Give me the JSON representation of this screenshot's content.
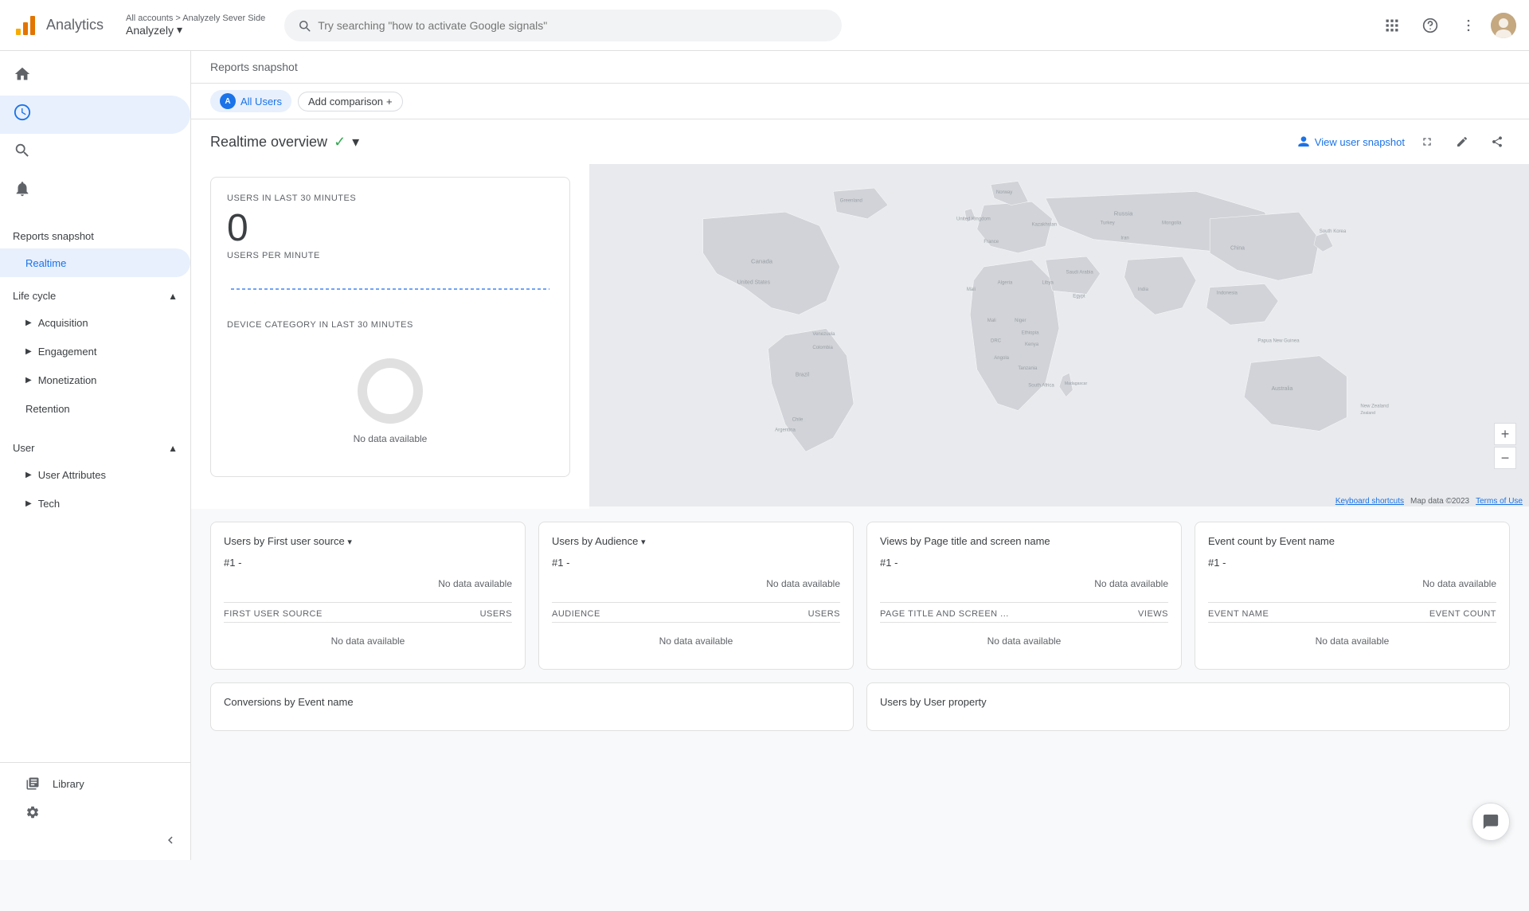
{
  "app": {
    "name": "Analytics",
    "logo_alt": "Google Analytics logo"
  },
  "account": {
    "path": "All accounts > Analyzely Sever Side",
    "name": "Analyzely",
    "dropdown_icon": "▾"
  },
  "search": {
    "placeholder": "Try searching \"how to activate Google signals\""
  },
  "topbar": {
    "grid_icon": "⋮⋮⋮",
    "help_icon": "?",
    "more_icon": "⋮"
  },
  "sidebar": {
    "reports_snapshot": "Reports snapshot",
    "realtime": "Realtime",
    "nav_icons": {
      "home": "🏠",
      "realtime": "📊",
      "search": "🔍",
      "alerts": "🔔"
    },
    "lifecycle": {
      "label": "Life cycle",
      "items": [
        "Acquisition",
        "Engagement",
        "Monetization",
        "Retention"
      ]
    },
    "user": {
      "label": "User",
      "items": [
        "User Attributes",
        "Tech"
      ]
    },
    "library": "Library",
    "settings": "⚙"
  },
  "filter": {
    "all_users": "All Users",
    "add_comparison": "Add comparison",
    "plus_icon": "+"
  },
  "realtime": {
    "title": "Realtime overview",
    "check_icon": "✓",
    "dropdown_icon": "▾",
    "view_snapshot": "View user snapshot",
    "expand_icon": "⤢",
    "edit_icon": "✎",
    "share_icon": "⤴"
  },
  "users_panel": {
    "users_label": "USERS IN LAST 30 MINUTES",
    "users_count": "0",
    "users_per_min_label": "USERS PER MINUTE",
    "device_label": "DEVICE CATEGORY IN LAST 30 MINUTES",
    "no_data": "No data available"
  },
  "map": {
    "keyboard_shortcuts": "Keyboard shortcuts",
    "map_data": "Map data ©2023",
    "terms": "Terms of Use",
    "zoom_in": "+",
    "zoom_out": "−"
  },
  "cards": [
    {
      "title": "Users by First user source",
      "rank": "#1  -",
      "no_data_top": "No data available",
      "col1": "FIRST USER SOURCE",
      "col2": "USERS",
      "no_data_bottom": "No data available"
    },
    {
      "title": "Users by Audience",
      "rank": "#1  -",
      "no_data_top": "No data available",
      "col1": "AUDIENCE",
      "col2": "USERS",
      "no_data_bottom": "No data available"
    },
    {
      "title": "Views by Page title and screen name",
      "rank": "#1  -",
      "no_data_top": "No data available",
      "col1": "PAGE TITLE AND SCREEN ...",
      "col2": "VIEWS",
      "no_data_bottom": "No data available"
    },
    {
      "title": "Event count by Event name",
      "rank": "#1  -",
      "no_data_top": "No data available",
      "col1": "EVENT NAME",
      "col2": "EVENT COUNT",
      "no_data_bottom": "No data available"
    }
  ],
  "bottom_cards": [
    {
      "title": "Conversions by Event name"
    },
    {
      "title": "Users by User property"
    }
  ],
  "colors": {
    "brand_blue": "#1a73e8",
    "active_bg": "#e8f0fe",
    "green": "#34a853",
    "border": "#e0e0e0",
    "text_secondary": "#5f6368"
  }
}
